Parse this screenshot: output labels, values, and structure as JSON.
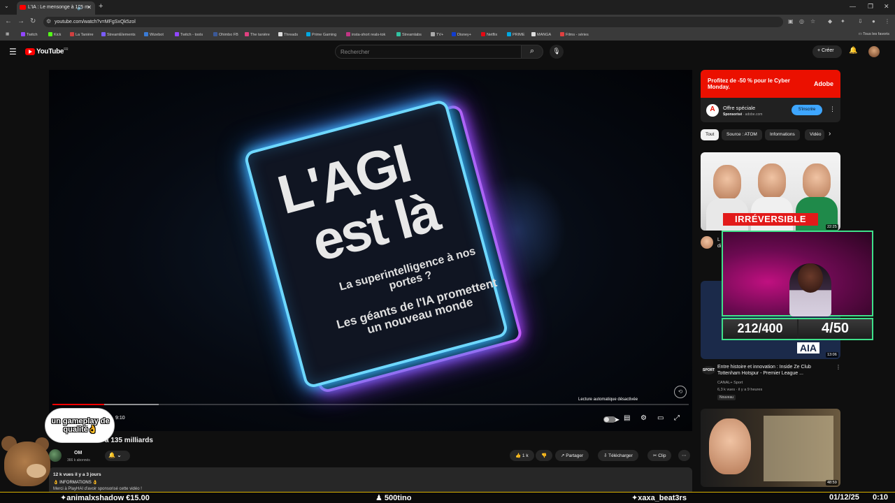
{
  "browser": {
    "tab_title": "L'IA : Le mensonge à 135 m",
    "url": "youtube.com/watch?v=MFgSxQk5zol",
    "bookmarks": [
      {
        "label": "Twitch",
        "color": "#9146ff"
      },
      {
        "label": "Kick",
        "color": "#53fc18"
      },
      {
        "label": "La Tanière",
        "color": "#d04040"
      },
      {
        "label": "StreamElements",
        "color": "#7a5cff"
      },
      {
        "label": "Wizebot",
        "color": "#3a7bd5"
      },
      {
        "label": "Twitch - tools",
        "color": "#9146ff"
      },
      {
        "label": "Ohimbo FB",
        "color": "#3b5998"
      },
      {
        "label": "The tanière",
        "color": "#e04080"
      },
      {
        "label": "Threads",
        "color": "#dddddd"
      },
      {
        "label": "Prime Gaming",
        "color": "#00a8e1"
      },
      {
        "label": "insta-short reals-tok",
        "color": "#c13584"
      },
      {
        "label": "Streamlabs",
        "color": "#31c3a2"
      },
      {
        "label": "TV+",
        "color": "#aaaaaa"
      },
      {
        "label": "Disney+",
        "color": "#113ccf"
      },
      {
        "label": "Netflix",
        "color": "#e50914"
      },
      {
        "label": "PRIME",
        "color": "#00a8e1"
      },
      {
        "label": "MANGA",
        "color": "#dddddd"
      },
      {
        "label": "Films - séries",
        "color": "#e04040"
      }
    ],
    "all_favorites": "Tous les favoris"
  },
  "youtube": {
    "logo_text": "YouTube",
    "logo_region": "FR",
    "search_placeholder": "Rechercher",
    "create_label": "Créer"
  },
  "player": {
    "line1": "L'AGI",
    "line2": "est là",
    "line3": "La superintelligence à nos portes ?",
    "line4": "Les géants de l'IA promettent un nouveau monde",
    "autoplay_message": "Lecture automatique désactivée",
    "time": "9:10",
    "progress_played": 0.081,
    "progress_buffered": 0.167
  },
  "video": {
    "title_visible": "à 135 milliards",
    "channel_name": "OM",
    "subscribers": "366 k abonnés",
    "likes": "1 k",
    "share_label": "Partager",
    "download_label": "Télécharger",
    "clip_label": "Clip",
    "desc_meta": "12 k vues  il y a 3 jours",
    "desc_line2": "👌 INFORMATIONS 👌",
    "desc_line3": "Merci à PlayHAI d'avoir sponsorisé cette vidéo !"
  },
  "ad": {
    "headline": "Profitez de -50 % pour le Cyber Monday.",
    "brand": "Adobe",
    "title": "Offre spéciale",
    "sponsored": "Sponsorisé",
    "domain": " · adobe.com",
    "button": "S'inscrire"
  },
  "chips": [
    "Tout",
    "Source : ATOM",
    "Informations",
    "Vidéo"
  ],
  "recommendations": [
    {
      "overlay": "IRRÉVERSIBLE",
      "duration": "22:25"
    },
    {
      "overlay": "AIA",
      "duration": "13:06",
      "title": "Entre histoire et innovation : Inside Ze Club Tottenham Hotspur - Premier League ...",
      "channel": "CANAL+ Sport",
      "meta": "6,3 k vues · il y a 9 heures",
      "badge": "Nouveau"
    },
    {
      "duration": "48:59"
    }
  ],
  "stream": {
    "bubble": "un gameplay de qualité👌",
    "counter_left": "212/400",
    "counter_right": "4/50",
    "ticker_1": "animalxshadow €15.00",
    "ticker_2": "500tino",
    "ticker_3": "xaxa_beat3rs",
    "date": "01/12/25",
    "clock": "0:10"
  },
  "colors": {
    "youtube_red": "#ff0000",
    "adobe_red": "#eb1000",
    "webcam_border": "#3fe08a",
    "link_blue": "#3ea6ff"
  }
}
